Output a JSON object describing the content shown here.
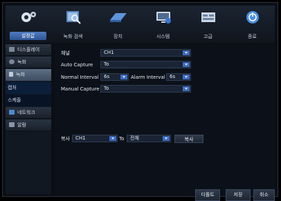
{
  "top_menu": [
    {
      "label": "설정값",
      "icon": "gear-icon",
      "active": true
    },
    {
      "label": "녹화 검색",
      "icon": "video-search-icon",
      "active": false
    },
    {
      "label": "장치",
      "icon": "hard-disk-icon",
      "active": false
    },
    {
      "label": "시스템",
      "icon": "monitor-icon",
      "active": false
    },
    {
      "label": "고급",
      "icon": "grid-panel-icon",
      "active": false
    },
    {
      "label": "종료",
      "icon": "power-icon",
      "active": false
    }
  ],
  "left_menu": [
    {
      "label": "디스플레이",
      "icon": "display-icon"
    },
    {
      "label": "녹화",
      "icon": "record-icon"
    },
    {
      "label": "녹화",
      "icon": "record-subicon"
    },
    {
      "label": "캡처",
      "icon": ""
    },
    {
      "label": "스케줄",
      "icon": ""
    },
    {
      "label": "네트워크",
      "icon": "network-icon"
    },
    {
      "label": "알람",
      "icon": "alarm-icon"
    }
  ],
  "form": {
    "channel_label": "채널",
    "channel_value": "CH1",
    "auto_capture_label": "Auto Capture",
    "auto_capture_value": "To",
    "normal_interval_label": "Normal Interval",
    "normal_interval_value": "6s",
    "alarm_interval_label": "Alarm Interval",
    "alarm_interval_value": "6s",
    "manual_capture_label": "Manual Capture",
    "manual_capture_value": "To"
  },
  "copy": {
    "label": "복사",
    "from_value": "CH1",
    "to_label": "To",
    "to_value": "전체",
    "button": "복사"
  },
  "footer": {
    "default": "디폴트",
    "save": "저장",
    "cancel": "취소"
  }
}
